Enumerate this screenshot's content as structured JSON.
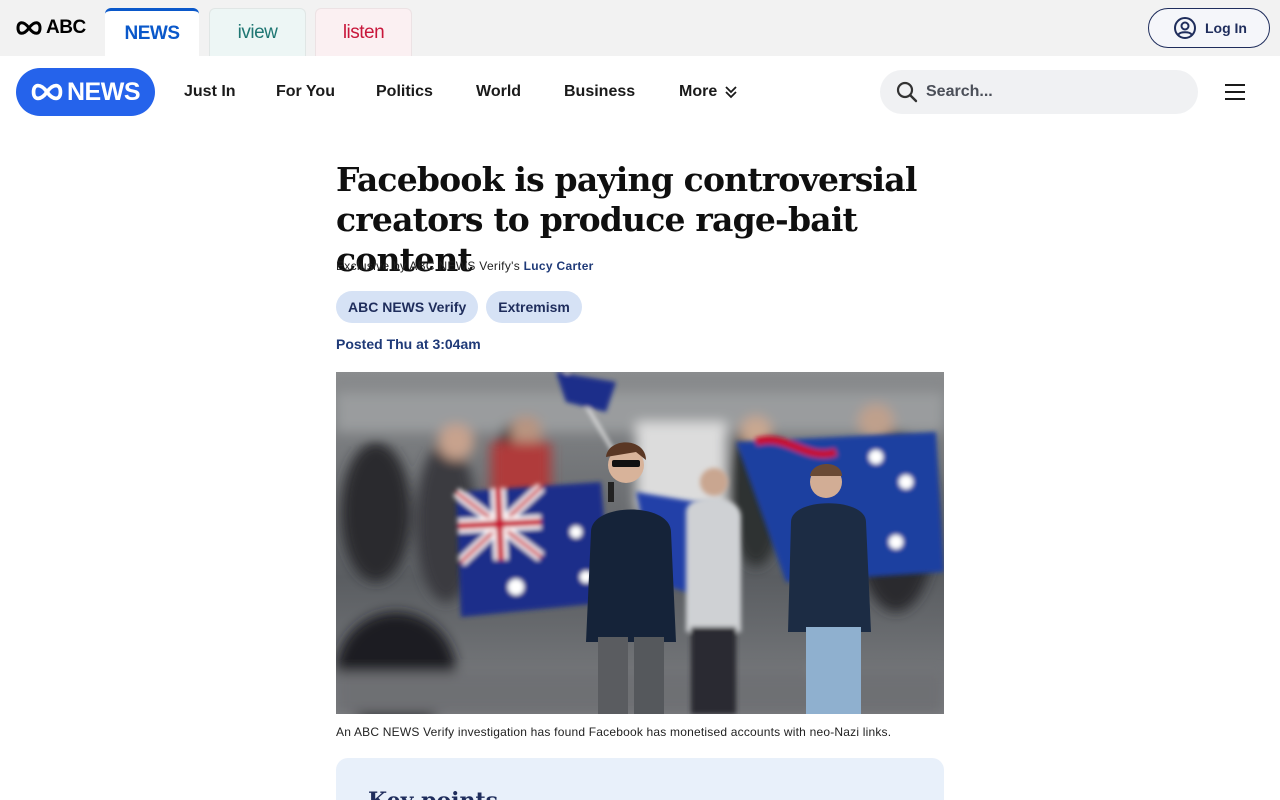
{
  "network": {
    "abc_logo": "ABC",
    "tabs": [
      {
        "label": "NEWS",
        "active": true
      },
      {
        "label": "iview",
        "active": false
      },
      {
        "label": "listen",
        "active": false
      }
    ],
    "login_label": "Log In"
  },
  "nav": {
    "logo": "NEWS",
    "items": [
      "Just In",
      "For You",
      "Politics",
      "World",
      "Business",
      "More"
    ],
    "search_placeholder": "Search..."
  },
  "article": {
    "headline": "Facebook is paying controversial creators to produce rage-bait content",
    "byline_prefix": "Exclusive by ABC NEWS Verify's ",
    "author": "Lucy Carter",
    "tags": [
      "ABC NEWS Verify",
      "Extremism"
    ],
    "posted": "Posted Thu at 3:04am",
    "caption": "An ABC NEWS Verify investigation has found Facebook has monetised accounts with neo-Nazi links.",
    "keypoints_title": "Key points"
  },
  "colors": {
    "brand_blue": "#2563eb",
    "news_tab": "#0a58ca",
    "iview": "#1f7773",
    "listen": "#c8173b",
    "navy": "#1f2d5c"
  }
}
